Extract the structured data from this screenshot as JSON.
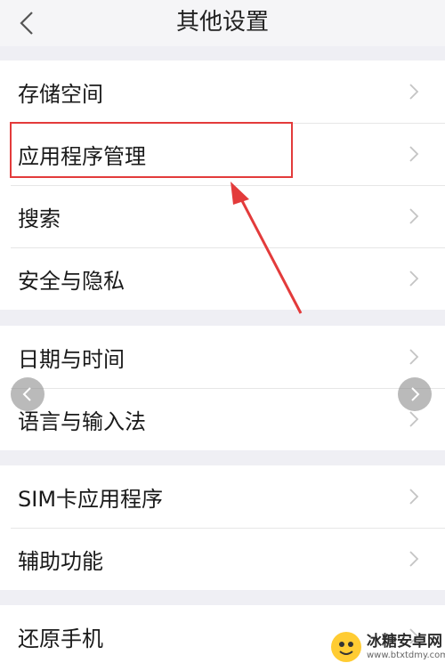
{
  "header": {
    "title": "其他设置",
    "back_icon": "chevron-left-icon"
  },
  "groups": [
    {
      "items": [
        {
          "label": "存储空间",
          "highlighted": false
        },
        {
          "label": "应用程序管理",
          "highlighted": true
        },
        {
          "label": "搜索",
          "highlighted": false
        },
        {
          "label": "安全与隐私",
          "highlighted": false
        }
      ]
    },
    {
      "items": [
        {
          "label": "日期与时间",
          "highlighted": false
        },
        {
          "label": "语言与输入法",
          "highlighted": false
        }
      ]
    },
    {
      "items": [
        {
          "label": "SIM卡应用程序",
          "highlighted": false
        },
        {
          "label": "辅助功能",
          "highlighted": false
        }
      ]
    },
    {
      "items": [
        {
          "label": "还原手机",
          "highlighted": false
        }
      ]
    }
  ],
  "annotation": {
    "box_color": "#e33b3b",
    "arrow_color": "#e33b3b"
  },
  "carousel": {
    "prev_icon": "chevron-left-icon",
    "next_icon": "chevron-right-icon"
  },
  "watermark": {
    "name": "冰糖安卓网",
    "url": "www.btxtdmy.com",
    "logo_color": "#ffcc33"
  },
  "colors": {
    "background": "#efeff4",
    "card": "#ffffff",
    "chevron": "#c4c4c4"
  }
}
